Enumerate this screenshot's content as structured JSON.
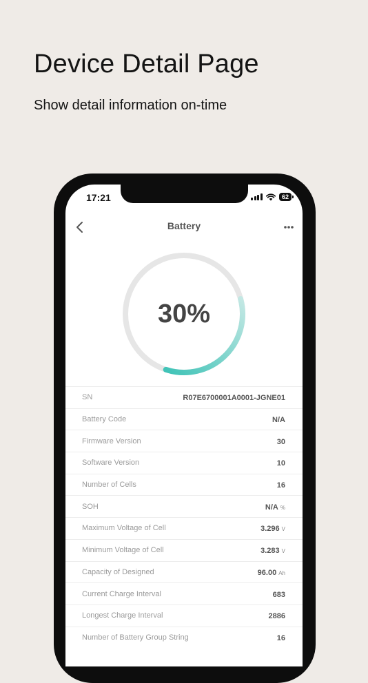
{
  "promo": {
    "title": "Device Detail Page",
    "subtitle": "Show detail information on-time"
  },
  "status_bar": {
    "time": "17:21",
    "battery_level": "62"
  },
  "nav": {
    "title": "Battery",
    "back_icon": "chevron-left-icon",
    "more_icon": "more-dots-icon"
  },
  "gauge": {
    "label": "30%",
    "value": 0.3,
    "colors": {
      "track": "#e6e6e6",
      "fill_start": "#c4e8e4",
      "fill_end": "#3fc3b7"
    }
  },
  "info_rows": [
    {
      "label": "SN",
      "value": "R07E6700001A0001-JGNE01",
      "unit": ""
    },
    {
      "label": "Battery Code",
      "value": "N/A",
      "unit": ""
    },
    {
      "label": "Firmware Version",
      "value": "30",
      "unit": ""
    },
    {
      "label": "Software Version",
      "value": "10",
      "unit": ""
    },
    {
      "label": "Number of Cells",
      "value": "16",
      "unit": ""
    },
    {
      "label": "SOH",
      "value": "N/A",
      "unit": "%"
    },
    {
      "label": "Maximum Voltage of Cell",
      "value": "3.296",
      "unit": "V"
    },
    {
      "label": "Minimum Voltage of Cell",
      "value": "3.283",
      "unit": "V"
    },
    {
      "label": "Capacity of Designed",
      "value": "96.00",
      "unit": "Ah"
    },
    {
      "label": "Current Charge Interval",
      "value": "683",
      "unit": ""
    },
    {
      "label": "Longest Charge Interval",
      "value": "2886",
      "unit": ""
    },
    {
      "label": "Number of Battery Group String",
      "value": "16",
      "unit": ""
    }
  ]
}
